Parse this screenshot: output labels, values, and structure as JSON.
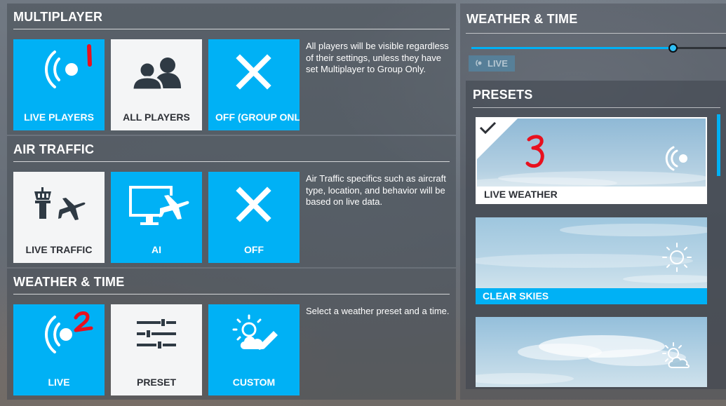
{
  "multiplayer": {
    "title": "MULTIPLAYER",
    "options": [
      {
        "label": "LIVE PLAYERS",
        "icon": "live-broadcast-icon",
        "selected": true,
        "annotation": "1"
      },
      {
        "label": "ALL PLAYERS",
        "icon": "users-icon",
        "selected": false
      },
      {
        "label": "OFF (GROUP ONLY)",
        "icon": "close-icon",
        "selected": false
      }
    ],
    "description": "All players will be visible regardless of their settings, unless they have set Multiplayer to Group Only."
  },
  "air_traffic": {
    "title": "AIR TRAFFIC",
    "options": [
      {
        "label": "LIVE TRAFFIC",
        "icon": "tower-airplane-icon",
        "selected": true
      },
      {
        "label": "AI",
        "icon": "monitor-airplane-icon",
        "selected": false
      },
      {
        "label": "OFF",
        "icon": "close-icon",
        "selected": false
      }
    ],
    "description": "Air Traffic specifics such as aircraft type, location, and behavior will be based on live data."
  },
  "weather_time": {
    "title": "WEATHER & TIME",
    "options": [
      {
        "label": "LIVE",
        "icon": "live-broadcast-icon",
        "selected": false,
        "annotation": "2"
      },
      {
        "label": "PRESET",
        "icon": "sliders-icon",
        "selected": true
      },
      {
        "label": "CUSTOM",
        "icon": "weather-edit-icon",
        "selected": false
      }
    ],
    "description": "Select a weather preset and a time."
  },
  "right_panel": {
    "title": "WEATHER & TIME",
    "time_slider": {
      "value": 0.79
    },
    "live_button": {
      "label": "LIVE",
      "icon": "live-broadcast-icon"
    },
    "presets": {
      "title": "PRESETS",
      "items": [
        {
          "label": "LIVE WEATHER",
          "icon": "live-broadcast-icon",
          "selected": true,
          "checked_icon": "checkmark-icon",
          "annotation": "3"
        },
        {
          "label": "CLEAR SKIES",
          "icon": "sun-icon",
          "selected": false
        },
        {
          "label": "",
          "icon": "partly-cloudy-icon",
          "selected": false
        }
      ]
    }
  },
  "colors": {
    "accent": "#00b1f5",
    "tile_white": "#f4f5f6",
    "annotation_red": "#e8101e",
    "text_dark": "#2d3036"
  }
}
